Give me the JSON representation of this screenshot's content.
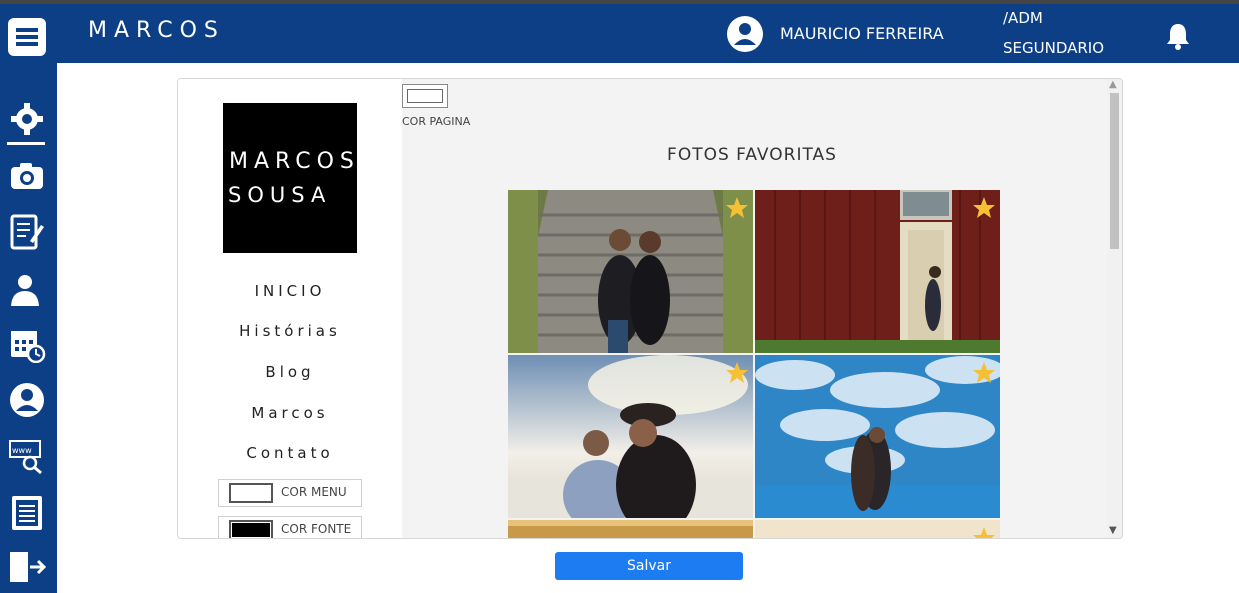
{
  "header": {
    "logo": "MARCOS",
    "user_name": "MAURICIO FERREIRA",
    "role_line1": "/ADM",
    "role_line2": "SEGUNDARIO",
    "icons": [
      "menu-icon",
      "user-icon",
      "bell-icon"
    ]
  },
  "sidebar": {
    "items": [
      {
        "icon": "gear-icon",
        "active": true
      },
      {
        "icon": "camera-icon"
      },
      {
        "icon": "edit-document-icon"
      },
      {
        "icon": "users-icon"
      },
      {
        "icon": "calendar-clock-icon"
      },
      {
        "icon": "user-circle-icon"
      },
      {
        "icon": "www-search-icon"
      },
      {
        "icon": "document-list-icon"
      },
      {
        "icon": "logout-icon"
      }
    ]
  },
  "editor": {
    "brand_line1": "MARCOS",
    "brand_line2": "SOUSA",
    "nav": [
      "INICIO",
      "Histórias",
      "Blog",
      "Marcos",
      "Contato"
    ],
    "color_menu_label": "COR MENU",
    "color_font_label": "COR FONTE",
    "color_page_label": "COR PAGINA",
    "menu_color": "#ffffff",
    "font_color": "#000000",
    "page_color": "#ffffff",
    "gallery_title": "FOTOS FAVORITAS",
    "photos": [
      {
        "name": "couple-on-stairs",
        "favorite": true
      },
      {
        "name": "couple-at-red-barn",
        "favorite": true
      },
      {
        "name": "couple-at-sunset-clouds",
        "favorite": true
      },
      {
        "name": "couple-under-blue-sky",
        "favorite": true
      },
      {
        "name": "photo-5",
        "favorite": true
      },
      {
        "name": "photo-6",
        "favorite": true
      }
    ]
  },
  "actions": {
    "save_label": "Salvar"
  },
  "colors": {
    "header_bg": "#0c3f86",
    "save_button": "#1e7cf2",
    "star": "#f5c033"
  }
}
